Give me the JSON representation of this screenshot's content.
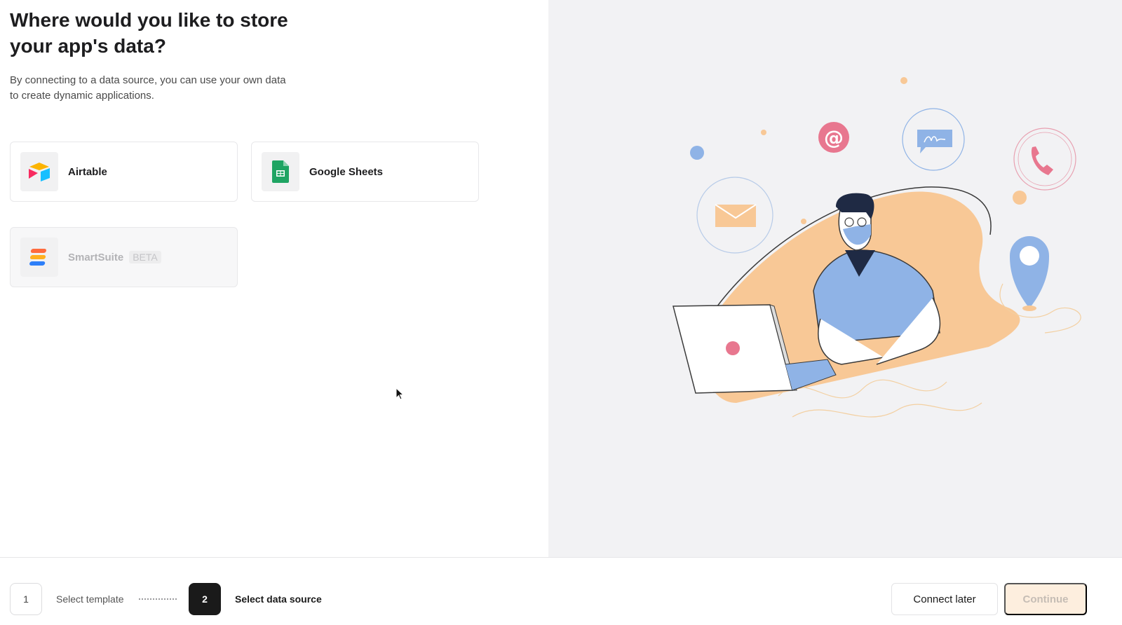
{
  "header": {
    "title": "Where would you like to store your app's data?",
    "subtitle": "By connecting to a data source, you can use your own data to create dynamic applications."
  },
  "sources": [
    {
      "label": "Airtable",
      "icon": "airtable-logo-icon",
      "enabled": true
    },
    {
      "label": "Google Sheets",
      "icon": "google-sheets-logo-icon",
      "enabled": true
    },
    {
      "label": "SmartSuite",
      "badge": "BETA",
      "icon": "smartsuite-logo-icon",
      "enabled": false
    }
  ],
  "stepper": {
    "steps": [
      {
        "number": "1",
        "label": "Select template",
        "active": false
      },
      {
        "number": "2",
        "label": "Select data source",
        "active": true
      }
    ]
  },
  "actions": {
    "connect_later": "Connect later",
    "continue": "Continue"
  },
  "colors": {
    "panel_bg": "#f2f2f4",
    "accent_peach": "#f8c896",
    "accent_blue": "#8fb3e6",
    "accent_pink": "#e8778f"
  }
}
